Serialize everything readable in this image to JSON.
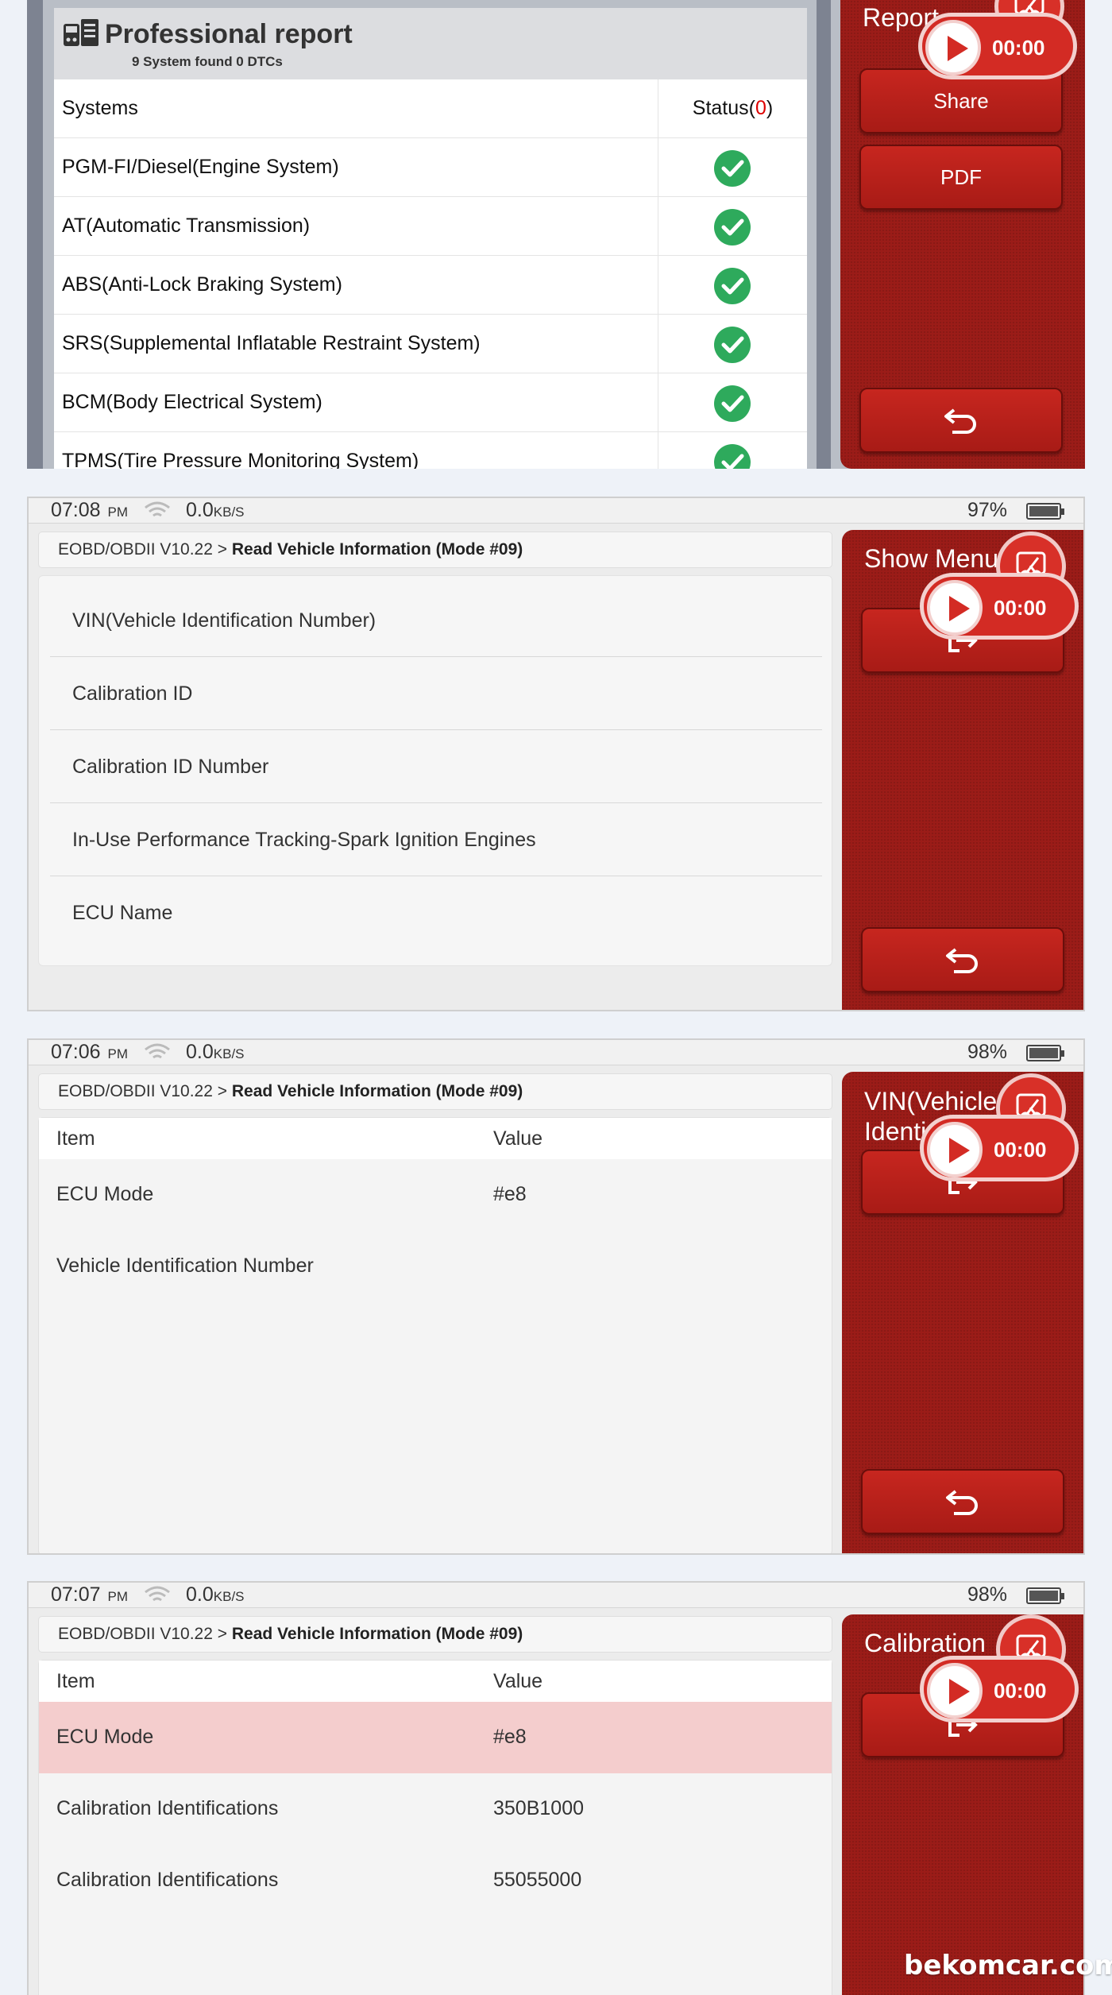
{
  "panel1": {
    "report_title": "Professional report",
    "report_subtitle": "9 System found 0 DTCs",
    "col_systems": "Systems",
    "col_status_prefix": "Status(",
    "col_status_count": "0",
    "col_status_suffix": ")",
    "rows": [
      "PGM-FI/Diesel(Engine System)",
      "AT(Automatic Transmission)",
      "ABS(Anti-Lock Braking System)",
      "SRS(Supplemental Inflatable Restraint System)",
      "BCM(Body Electrical System)",
      "TPMS(Tire Pressure Monitoring System)"
    ],
    "side_title": "Report",
    "share_label": "Share",
    "pdf_label": "PDF",
    "recorder_time": "00:00"
  },
  "panel2": {
    "status": {
      "time": "07:08",
      "ampm": "PM",
      "speed": "0.0",
      "unit": "KB/S",
      "battery": "97%"
    },
    "crumb_app": "EOBD/OBDII V10.22",
    "crumb_sep": ">",
    "crumb_page": "Read Vehicle Information (Mode #09)",
    "items": [
      "VIN(Vehicle Identification Number)",
      "Calibration ID",
      "Calibration ID Number",
      "In-Use Performance Tracking-Spark Ignition Engines",
      "ECU Name"
    ],
    "side_title": "Show Menu",
    "recorder_time": "00:00"
  },
  "panel3": {
    "status": {
      "time": "07:06",
      "ampm": "PM",
      "speed": "0.0",
      "unit": "KB/S",
      "battery": "98%"
    },
    "crumb_app": "EOBD/OBDII V10.22",
    "crumb_sep": ">",
    "crumb_page": "Read Vehicle Information (Mode #09)",
    "col_item": "Item",
    "col_value": "Value",
    "rows": [
      {
        "item": "ECU Mode",
        "value": "#e8"
      },
      {
        "item": "Vehicle Identification Number",
        "value": ""
      }
    ],
    "side_title_1": "VIN(Vehicle",
    "side_title_2": "Identi",
    "recorder_time": "00:00"
  },
  "panel4": {
    "status": {
      "time": "07:07",
      "ampm": "PM",
      "speed": "0.0",
      "unit": "KB/S",
      "battery": "98%"
    },
    "crumb_app": "EOBD/OBDII V10.22",
    "crumb_sep": ">",
    "crumb_page": "Read Vehicle Information (Mode #09)",
    "col_item": "Item",
    "col_value": "Value",
    "rows": [
      {
        "item": "ECU Mode",
        "value": "#e8"
      },
      {
        "item": "Calibration Identifications",
        "value": "350B1000"
      },
      {
        "item": "Calibration Identifications",
        "value": "55055000"
      }
    ],
    "side_title": "Calibration",
    "recorder_time": "00:00"
  },
  "watermark": "bekomcar.com",
  "colors": {
    "accent_red": "#9b1c18",
    "button_red": "#c7261f",
    "ok_green": "#2eaa5c",
    "highlight_row": "#f4cdcd"
  }
}
